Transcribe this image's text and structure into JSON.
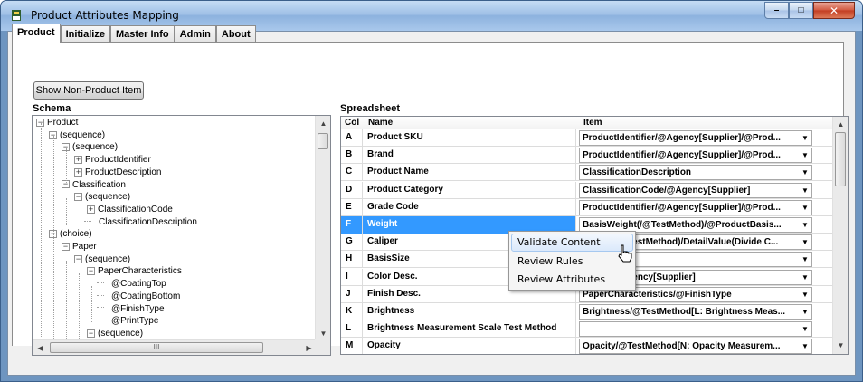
{
  "window": {
    "title": "Product Attributes Mapping",
    "minimize": "–",
    "maximize": "□",
    "close": "✕"
  },
  "tabs": [
    "Product",
    "Initialize",
    "Master Info",
    "Admin",
    "About"
  ],
  "show_button": "Show  Non-Product Item",
  "schema": {
    "label": "Schema",
    "nodes": [
      {
        "text": "Product",
        "toggle": "−"
      },
      {
        "text": "(sequence)",
        "toggle": "−"
      },
      {
        "text": "(sequence)",
        "toggle": "−"
      },
      {
        "text": "ProductIdentifier",
        "toggle": "+"
      },
      {
        "text": "ProductDescription",
        "toggle": "+"
      },
      {
        "text": "Classification",
        "toggle": "−"
      },
      {
        "text": "(sequence)",
        "toggle": "−"
      },
      {
        "text": "ClassificationCode",
        "toggle": "+"
      },
      {
        "text": "ClassificationDescription",
        "toggle": ""
      },
      {
        "text": "(choice)",
        "toggle": "−"
      },
      {
        "text": "Paper",
        "toggle": "−"
      },
      {
        "text": "(sequence)",
        "toggle": "−"
      },
      {
        "text": "PaperCharacteristics",
        "toggle": "−"
      },
      {
        "text": "@CoatingTop",
        "toggle": ""
      },
      {
        "text": "@CoatingBottom",
        "toggle": ""
      },
      {
        "text": "@FinishType",
        "toggle": ""
      },
      {
        "text": "@PrintType",
        "toggle": ""
      },
      {
        "text": "(sequence)",
        "toggle": "−"
      }
    ],
    "hscroll_grip": "III"
  },
  "spreadsheet": {
    "label": "Spreadsheet",
    "headers": {
      "col": "Col",
      "name": "Name",
      "item": "Item"
    },
    "rows": [
      {
        "col": "A",
        "name": "Product SKU",
        "item": "ProductIdentifier/@Agency[Supplier]/@Prod..."
      },
      {
        "col": "B",
        "name": "Brand",
        "item": "ProductIdentifier/@Agency[Supplier]/@Prod..."
      },
      {
        "col": "C",
        "name": "Product Name",
        "item": "ClassificationDescription"
      },
      {
        "col": "D",
        "name": "Product Category",
        "item": "ClassificationCode/@Agency[Supplier]"
      },
      {
        "col": "E",
        "name": "Grade Code",
        "item": "ProductIdentifier/@Agency[Supplier]/@Prod..."
      },
      {
        "col": "F",
        "name": "Weight",
        "item": "BasisWeight(/@TestMethod)/@ProductBasis..."
      },
      {
        "col": "G",
        "name": "Caliper",
        "item": "Caliper(/@TestMethod)/DetailValue(Divide C..."
      },
      {
        "col": "H",
        "name": "BasisSize",
        "item": ""
      },
      {
        "col": "I",
        "name": "Color Desc.",
        "item": "Color(/@Agency[Supplier]"
      },
      {
        "col": "J",
        "name": "Finish Desc.",
        "item": "PaperCharacteristics/@FinishType"
      },
      {
        "col": "K",
        "name": "Brightness",
        "item": "Brightness/@TestMethod[L: Brightness Meas..."
      },
      {
        "col": "L",
        "name": "Brightness Measurement Scale Test Method",
        "item": ""
      },
      {
        "col": "M",
        "name": "Opacity",
        "item": "Opacity/@TestMethod[N: Opacity Measurem..."
      }
    ]
  },
  "context_menu": [
    "Validate Content",
    "Review Rules",
    "Review Attributes"
  ],
  "colors": {
    "selection": "#3399ff",
    "frame": "#6e95c0"
  }
}
